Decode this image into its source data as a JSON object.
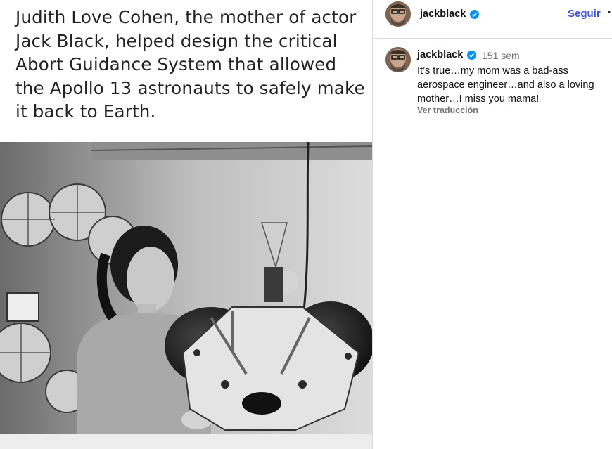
{
  "post": {
    "caption_image_text": "Judith Love Cohen, the mother of actor Jack Black, helped design the critical Abort Guidance System that allowed the Apollo 13 astronauts to safely make it back to Earth."
  },
  "header": {
    "username": "jackblack",
    "follow_label": "Seguir",
    "more_label": "·"
  },
  "comment": {
    "username": "jackblack",
    "time": "151 sem",
    "text": "It’s true…my mom was a bad-ass aerospace engineer…and also a loving mother…I miss you mama!",
    "translate_label": "Ver traducción"
  },
  "colors": {
    "accent": "#3c53d6",
    "verified": "#0095f6",
    "muted": "#737373"
  },
  "icons": {
    "verified": "verified-badge-icon"
  }
}
